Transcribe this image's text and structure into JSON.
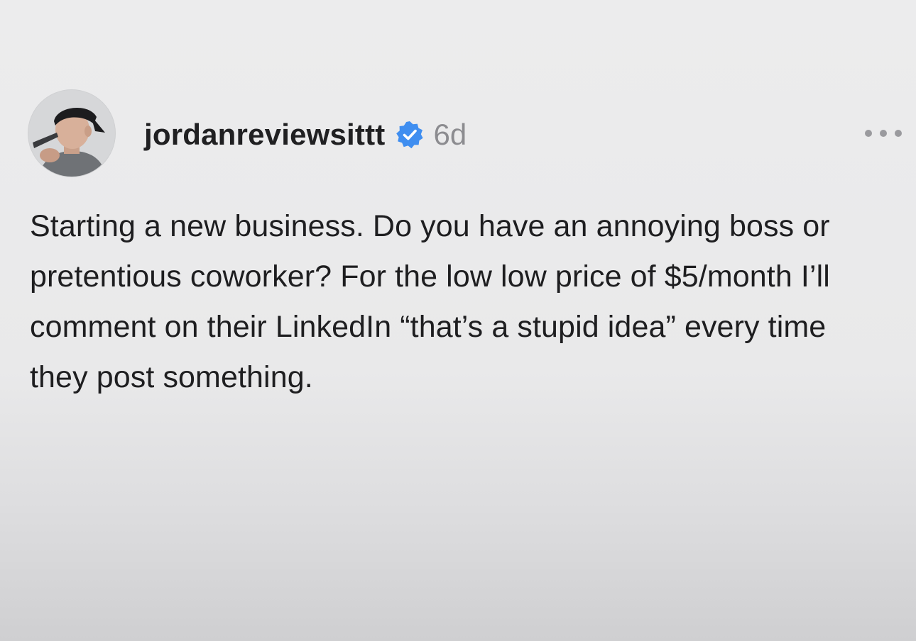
{
  "post": {
    "author": {
      "username": "jordanreviewsittt",
      "verified_icon": "verified-badge-icon",
      "avatar_icon": "profile-photo"
    },
    "time_ago": "6d",
    "more_icon": "more-options-icon",
    "text": "Starting a new business. Do you have an annoying boss or pretentious coworker? For the low low price of $5/month I’ll comment on their LinkedIn “that’s a stupid idea” every time they post something."
  },
  "colors": {
    "verified_blue": "#3f8ef0",
    "timestamp_gray": "#8c8c90",
    "text_dark": "#1e1e20"
  }
}
